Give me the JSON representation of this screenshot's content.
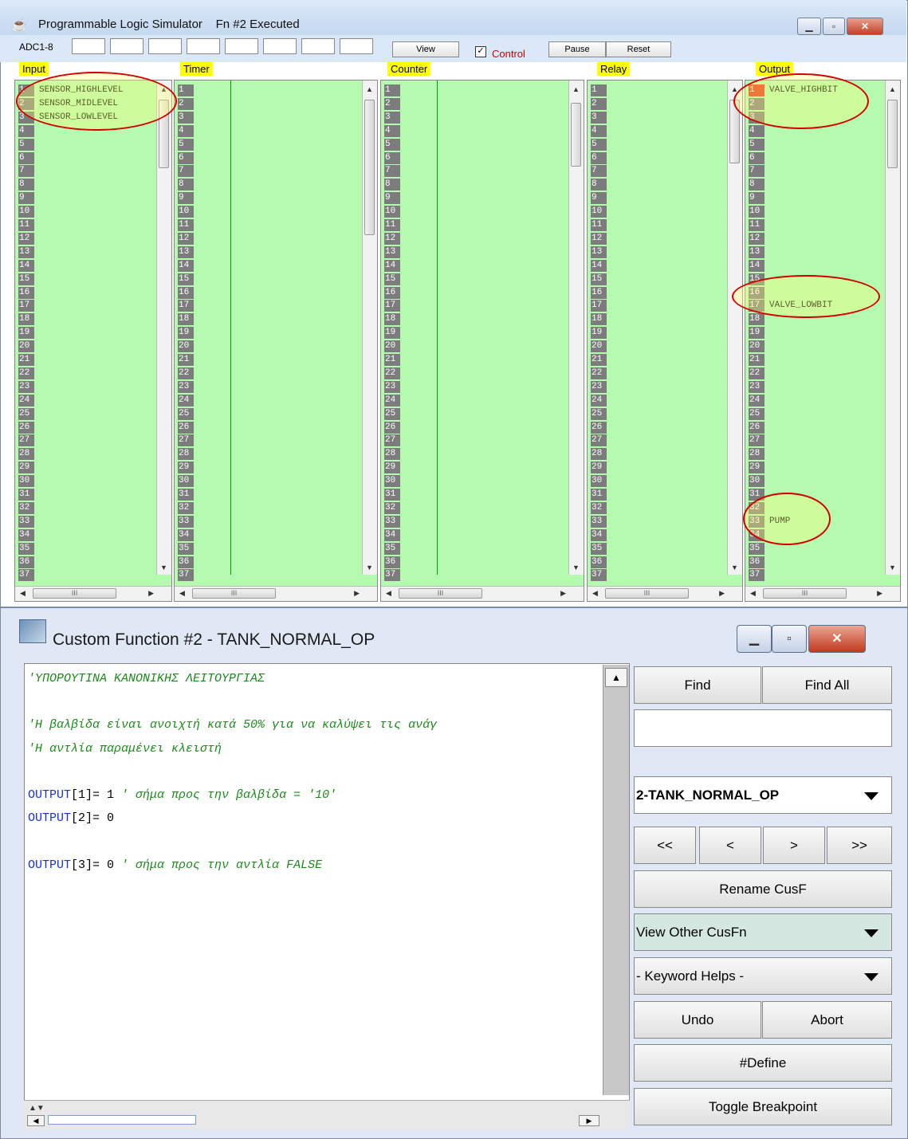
{
  "top_window": {
    "title": "Programmable Logic Simulator",
    "status": "Fn #2 Executed",
    "adc_label": "ADC1-8",
    "view_button": "View",
    "control_label": "Control",
    "control_checked": true,
    "pause_button": "Pause",
    "reset_button": "Reset",
    "sections": {
      "input": "Input",
      "timer": "Timer",
      "counter": "Counter",
      "relay": "Relay",
      "output": "Output"
    },
    "input_items": [
      {
        "row": "1",
        "label": "SENSOR_HIGHLEVEL"
      },
      {
        "row": "2",
        "label": "SENSOR_MIDLEVEL"
      },
      {
        "row": "3",
        "label": "SENSOR_LOWLEVEL"
      }
    ],
    "output_items": [
      {
        "row": "1",
        "label": "VALVE_HIGHBIT",
        "active": true
      },
      {
        "row": "17",
        "label": "VALVE_LOWBIT",
        "active": false
      },
      {
        "row": "33",
        "label": "PUMP",
        "active": false
      }
    ],
    "row_count": 37,
    "scroll_marker": "III"
  },
  "bottom_window": {
    "title": "Custom Function #2 - TANK_NORMAL_OP",
    "code_lines": [
      {
        "type": "comment",
        "text": "'ΥΠΟΡΟΥΤΙΝΑ ΚΑΝΟΝΙΚΗΣ ΛΕΙΤΟΥΡΓΙΑΣ"
      },
      {
        "type": "blank",
        "text": ""
      },
      {
        "type": "comment",
        "text": "'Η βαλβίδα είναι ανοιχτή κατά 50% για να καλύψει τις ανάγ"
      },
      {
        "type": "comment",
        "text": "'Η αντλία παραμένει κλειστή"
      },
      {
        "type": "blank",
        "text": ""
      },
      {
        "type": "code",
        "kw": "OUTPUT",
        "plain": "[1]= 1 ",
        "comment": "' σήμα προς την βαλβίδα = '10'"
      },
      {
        "type": "code",
        "kw": "OUTPUT",
        "plain": "[2]= 0",
        "comment": ""
      },
      {
        "type": "blank",
        "text": ""
      },
      {
        "type": "code",
        "kw": "OUTPUT",
        "plain": "[3]= 0 ",
        "comment": "' σήμα προς την αντλία FALSE"
      }
    ],
    "buttons": {
      "find": "Find",
      "find_all": "Find All",
      "first": "<<",
      "prev": "<",
      "next": ">",
      "last": ">>",
      "rename": "Rename CusF",
      "undo": "Undo",
      "abort": "Abort",
      "define": "#Define",
      "toggle_breakpoint": "Toggle Breakpoint"
    },
    "find_input_value": "",
    "function_select": "2-TANK_NORMAL_OP",
    "view_other_select": "View Other CusFn",
    "keyword_select": "- Keyword Helps -"
  }
}
